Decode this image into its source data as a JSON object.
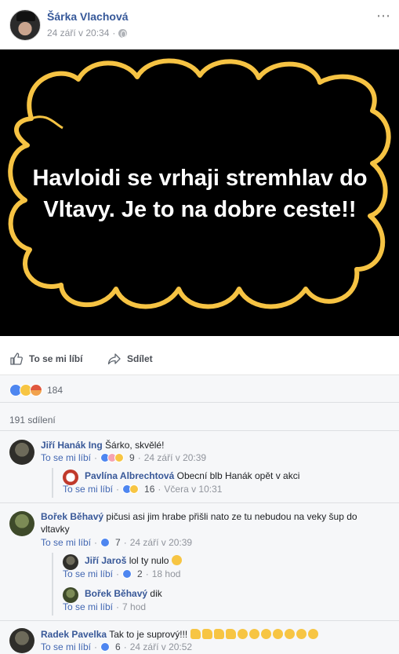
{
  "post": {
    "author": "Šárka Vlachová",
    "timestamp": "24 září v 20:34",
    "meta_separator": "·",
    "more_icon": "⋯",
    "image_text": "Havloidi se vrhaji stremhlav do Vltavy. Je to na dobre ceste!!"
  },
  "actions": {
    "like_label": "To se mi líbí",
    "share_label": "Sdílet"
  },
  "stats": {
    "reactions_count": "184",
    "shares_label": "191 sdílení"
  },
  "comments": [
    {
      "author": "Jiří Hanák Ing",
      "text": "Šárko, skvělé!",
      "like_label": "To se mi líbí",
      "reactions_count": "9",
      "time": "24 září v 20:39",
      "replies": [
        {
          "author": "Pavlína Albrechtová",
          "text": "Obecní blb Hanák opět v akci",
          "like_label": "To se mi líbí",
          "reactions_count": "16",
          "time": "Včera v 10:31"
        }
      ]
    },
    {
      "author": "Bořek Běhavý",
      "text": "pičusi asi jim hrabe přišli nato ze tu nebudou na veky šup do",
      "text_line2": "vltavky",
      "like_label": "To se mi líbí",
      "reactions_count": "7",
      "time": "24 září v 20:39",
      "replies": [
        {
          "author": "Jiří Jaroš",
          "text": "lol ty nulo",
          "like_label": "To se mi líbí",
          "reactions_count": "2",
          "time": "18 hod"
        },
        {
          "author": "Bořek Běhavý",
          "text": "dik",
          "like_label": "To se mi líbí",
          "time": "7 hod"
        }
      ]
    },
    {
      "author": "Radek Pavelka",
      "text": "Tak to je suprový!!!",
      "like_label": "To se mi líbí",
      "reactions_count": "6",
      "time": "24 září v 20:52"
    }
  ],
  "colors": {
    "link_blue": "#365899",
    "cloud_yellow": "#f6c343",
    "like_blue": "#4e86f0"
  }
}
